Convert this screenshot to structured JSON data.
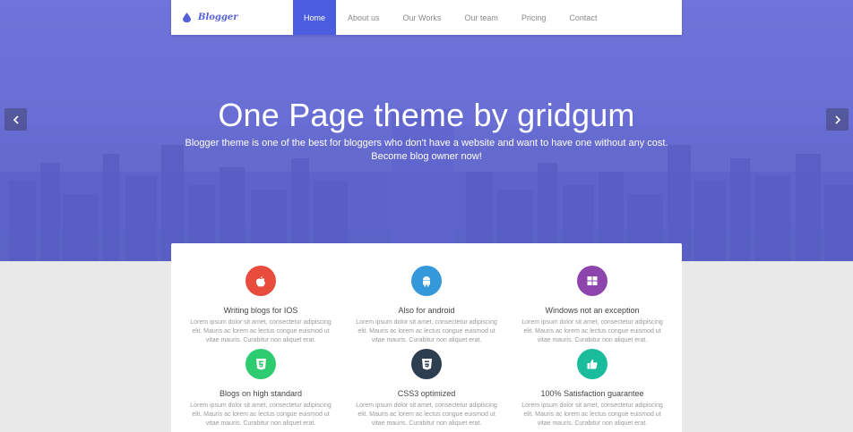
{
  "brand": {
    "name": "Blogger",
    "color": "#5560d8"
  },
  "nav": {
    "items": [
      {
        "label": "Home",
        "active": true
      },
      {
        "label": "About us",
        "active": false
      },
      {
        "label": "Our Works",
        "active": false
      },
      {
        "label": "Our team",
        "active": false
      },
      {
        "label": "Pricing",
        "active": false
      },
      {
        "label": "Contact",
        "active": false
      }
    ],
    "active_color": "#4a5ce0"
  },
  "hero": {
    "title": "One Page theme by gridgum",
    "subtitle_line1": "Blogger theme is one of the best for bloggers who don't have a website and want to have one without any cost.",
    "subtitle_line2": "Become blog owner now!",
    "prev_icon": "chevron-left-icon",
    "next_icon": "chevron-right-icon",
    "overlay_color": "#6a70d3"
  },
  "features": [
    {
      "title": "Writing blogs for IOS",
      "icon": "apple-icon",
      "color": "#e74c3c",
      "desc": "Lorem ipsum dolor sit amet, consectetur adipiscing elit. Mauris ac lorem ac lectus congue euismod ut vitae mauris. Curabitur non aliquet erat."
    },
    {
      "title": "Also for android",
      "icon": "android-icon",
      "color": "#3498db",
      "desc": "Lorem ipsum dolor sit amet, consectetur adipiscing elit. Mauris ac lorem ac lectus congue euismod ut vitae mauris. Curabitur non aliquet erat."
    },
    {
      "title": "Windows not an exception",
      "icon": "windows-icon",
      "color": "#8e44ad",
      "desc": "Lorem ipsum dolor sit amet, consectetur adipiscing elit. Mauris ac lorem ac lectus congue euismod ut vitae mauris. Curabitur non aliquet erat."
    },
    {
      "title": "Blogs on high standard",
      "icon": "html5-icon",
      "color": "#2ecc71",
      "desc": "Lorem ipsum dolor sit amet, consectetur adipiscing elit. Mauris ac lorem ac lectus congue euismod ut vitae mauris. Curabitur non aliquet erat."
    },
    {
      "title": "CSS3 optimized",
      "icon": "css3-icon",
      "color": "#2c3e50",
      "desc": "Lorem ipsum dolor sit amet, consectetur adipiscing elit. Mauris ac lorem ac lectus congue euismod ut vitae mauris. Curabitur non aliquet erat."
    },
    {
      "title": "100% Satisfaction guarantee",
      "icon": "thumbs-up-icon",
      "color": "#1abc9c",
      "desc": "Lorem ipsum dolor sit amet, consectetur adipiscing elit. Mauris ac lorem ac lectus congue euismod ut vitae mauris. Curabitur non aliquet erat."
    }
  ]
}
